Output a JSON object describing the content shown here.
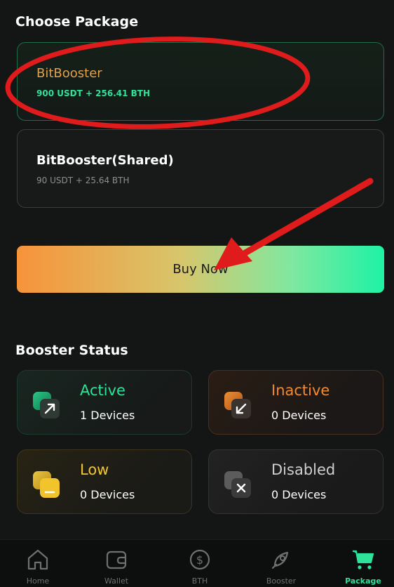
{
  "choose_package": {
    "title": "Choose Package",
    "packages": [
      {
        "name": "BitBooster",
        "price": "900 USDT + 256.41 BTH",
        "selected": true
      },
      {
        "name": "BitBooster(Shared)",
        "price": "90 USDT + 25.64 BTH",
        "selected": false
      }
    ]
  },
  "buy_button": {
    "label": "Buy Now"
  },
  "booster_status": {
    "title": "Booster Status",
    "items": [
      {
        "label": "Active",
        "count": "1 Devices",
        "color": "#2ee29a",
        "icon": "arrow-up-right-icon"
      },
      {
        "label": "Inactive",
        "count": "0 Devices",
        "color": "#f28a2e",
        "icon": "arrow-down-left-icon"
      },
      {
        "label": "Low",
        "count": "0 Devices",
        "color": "#f3c62d",
        "icon": "minus-icon"
      },
      {
        "label": "Disabled",
        "count": "0 Devices",
        "color": "#cfcfcf",
        "icon": "x-icon"
      }
    ]
  },
  "tabbar": {
    "tabs": [
      {
        "label": "Home",
        "icon": "home-icon"
      },
      {
        "label": "Wallet",
        "icon": "wallet-icon"
      },
      {
        "label": "BTH",
        "icon": "dollar-coin-icon"
      },
      {
        "label": "Booster",
        "icon": "rocket-icon"
      },
      {
        "label": "Package",
        "icon": "cart-icon",
        "active": true
      }
    ]
  },
  "colors": {
    "accent_green": "#2ee29a",
    "accent_orange": "#f28a2e",
    "annotation_red": "#e01b1b"
  }
}
